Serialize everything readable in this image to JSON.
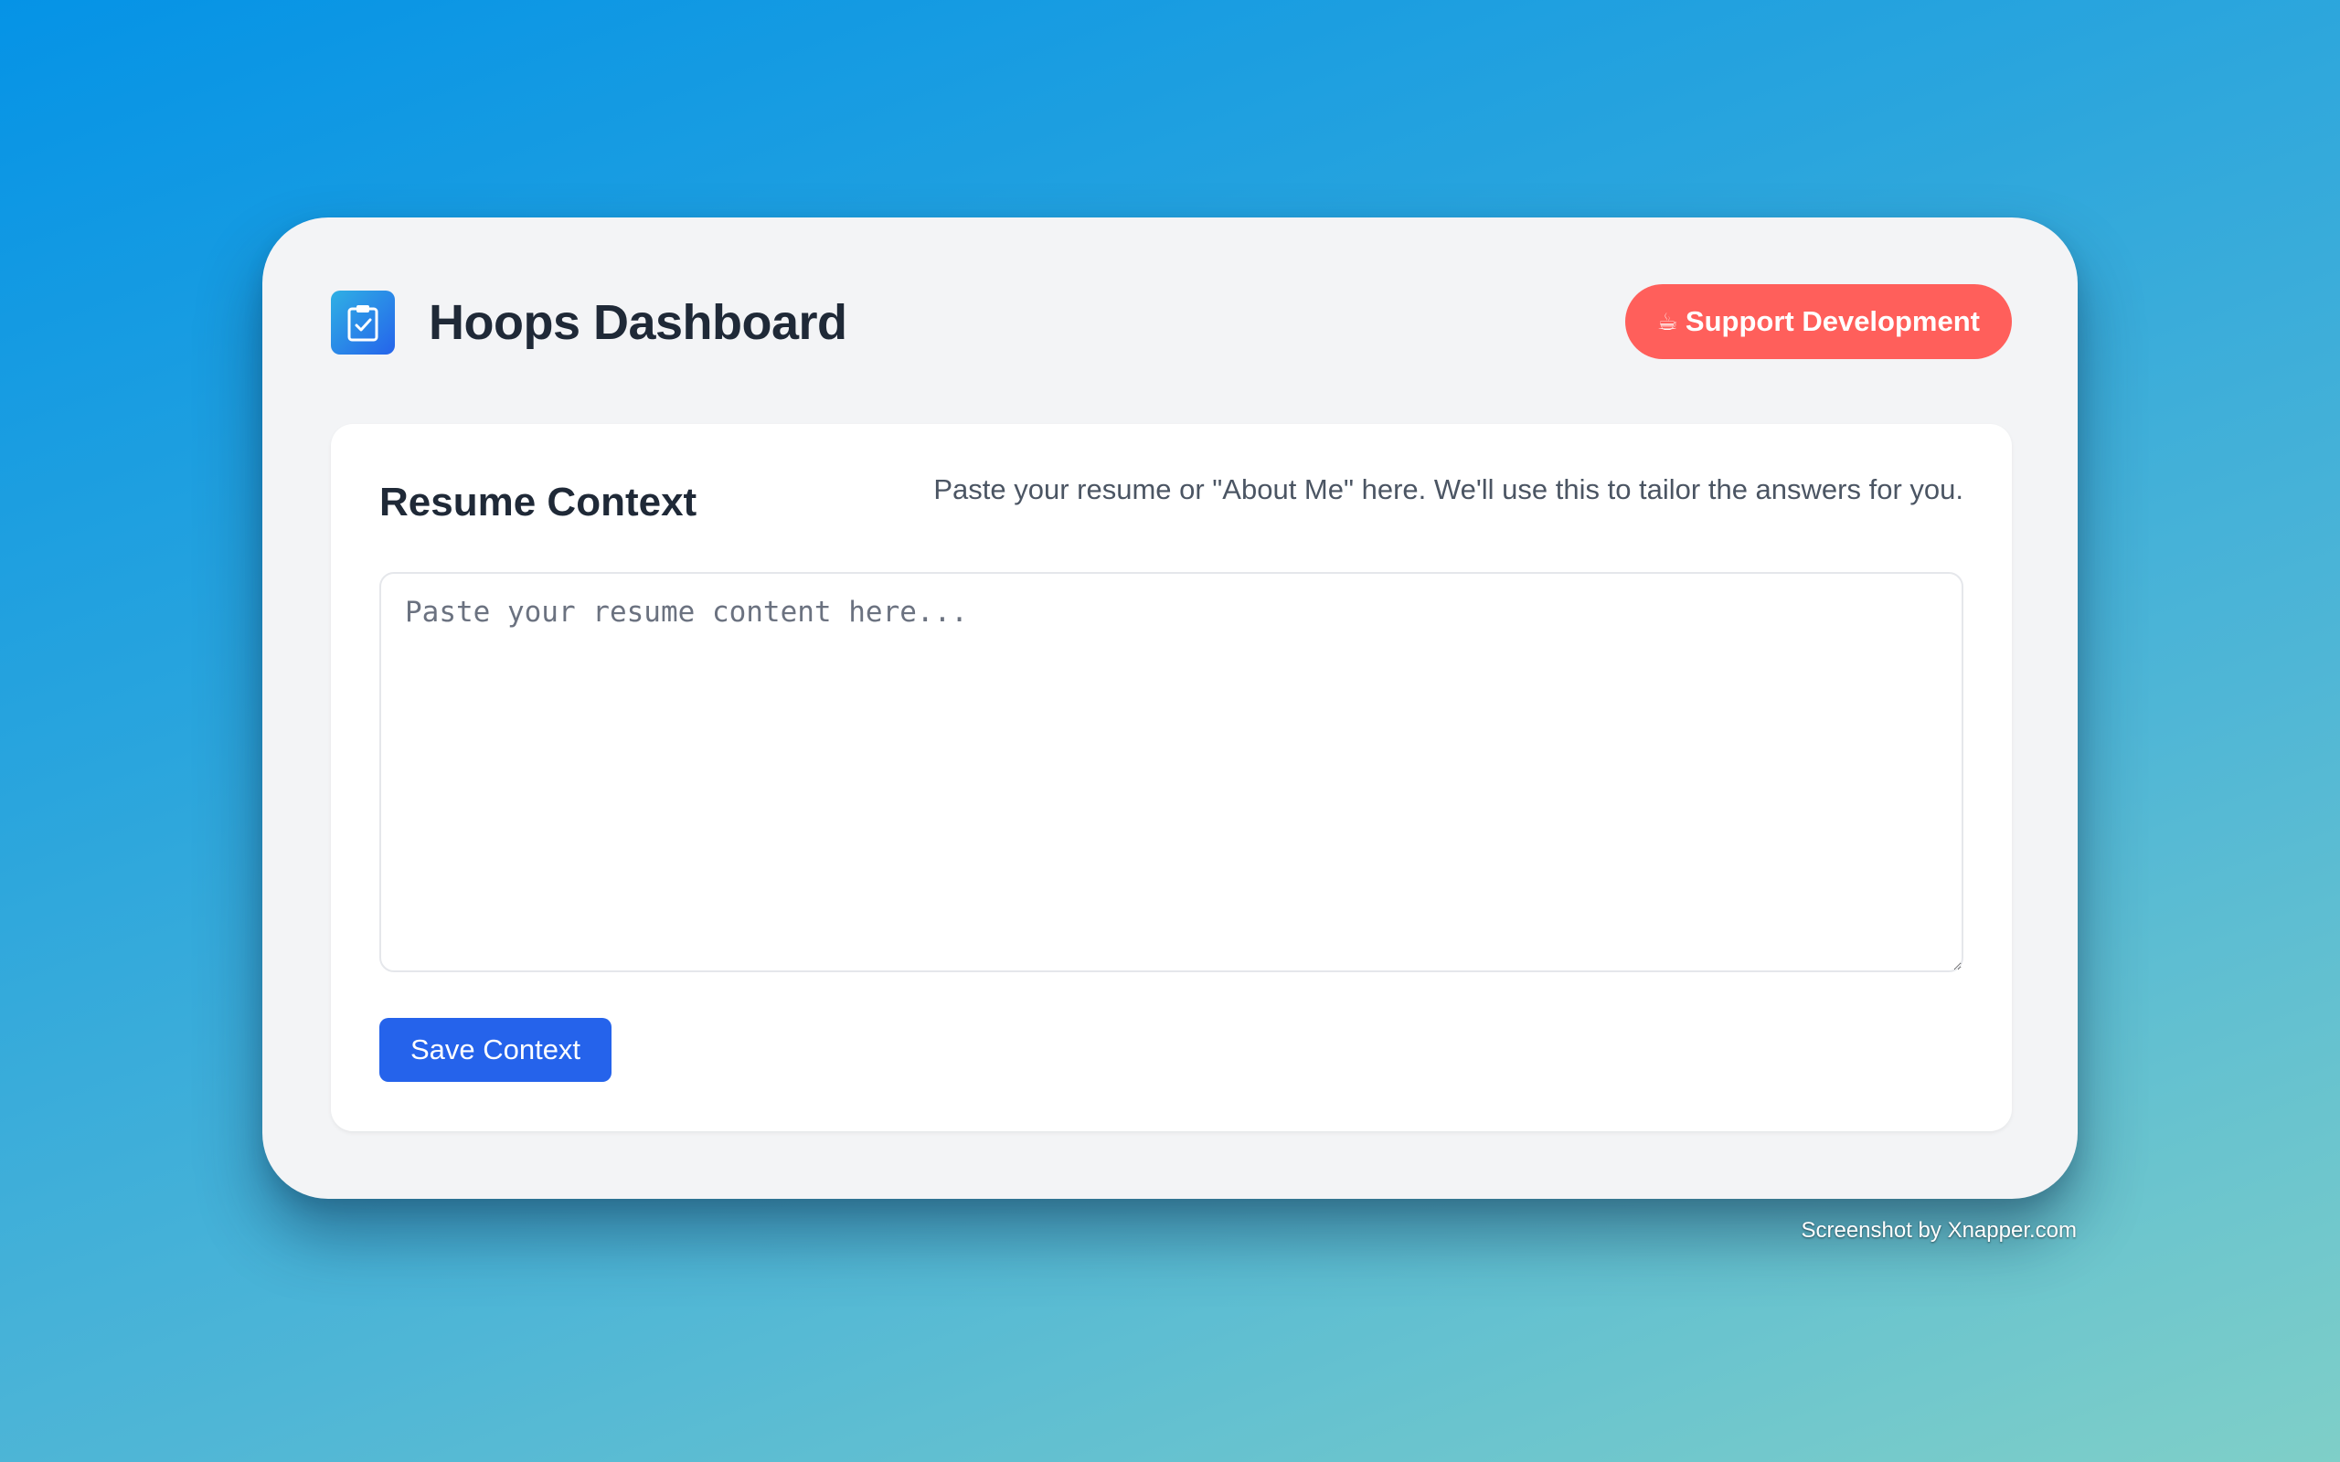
{
  "header": {
    "logo_icon": "clipboard-check-icon",
    "title": "Hoops Dashboard",
    "support_button": {
      "emoji": "☕",
      "label": "Support Development",
      "color": "#ff5f5b"
    }
  },
  "resume_card": {
    "title": "Resume Context",
    "description": "Paste your resume or \"About Me\" here. We'll use this to tailor the answers for you.",
    "input": {
      "value": "",
      "placeholder": "Paste your resume content here..."
    },
    "save_button_label": "Save Context"
  },
  "colors": {
    "primary": "#2563eb",
    "accent": "#ff5f5b",
    "window_bg": "#f3f4f6",
    "text_dark": "#1f2937"
  },
  "watermark": "Screenshot by Xnapper.com"
}
